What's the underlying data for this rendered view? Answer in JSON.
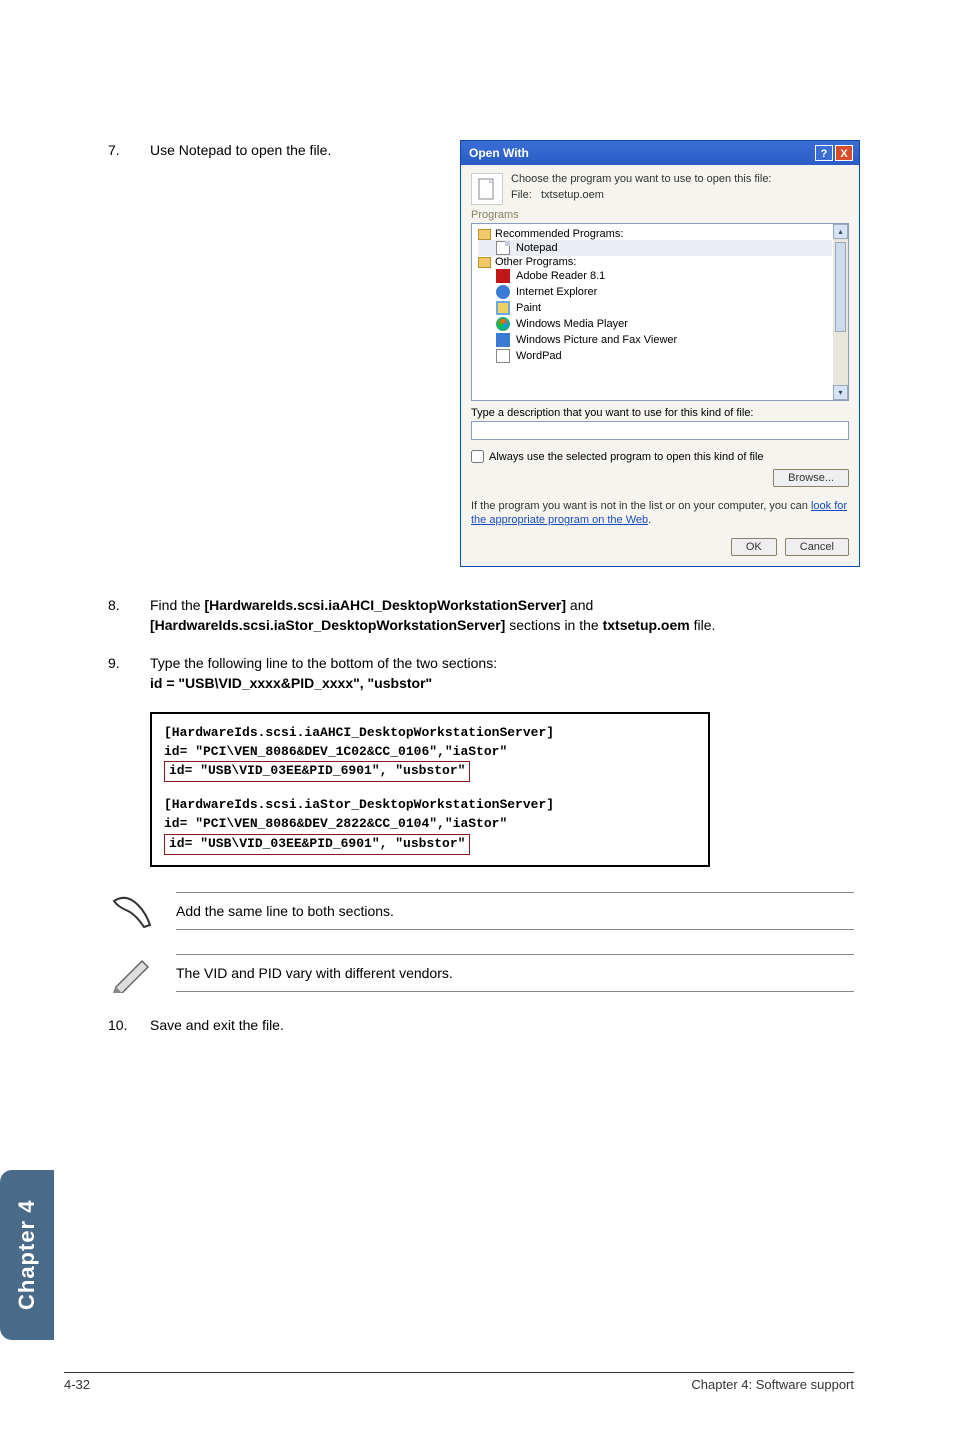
{
  "steps": {
    "s7": {
      "num": "7.",
      "text": "Use Notepad to open the file."
    },
    "s8": {
      "num": "8.",
      "prefix": "Find the ",
      "bold1": "[HardwareIds.scsi.iaAHCI_DesktopWorkstationServer]",
      "mid": " and ",
      "bold2": "[HardwareIds.scsi.iaStor_DesktopWorkstationServer]",
      "suffix1": " sections in the ",
      "bold3": "txtsetup.oem",
      "suffix2": " file."
    },
    "s9": {
      "num": "9.",
      "line1": "Type the following line to the bottom of the two sections:",
      "line2": "id = \"USB\\VID_xxxx&PID_xxxx\", \"usbstor\""
    },
    "s10": {
      "num": "10.",
      "text": "Save and exit the file."
    }
  },
  "dialog": {
    "title": "Open With",
    "help": "?",
    "close": "X",
    "choose": "Choose the program you want to use to open this file:",
    "file_label": "File:",
    "file_name": "txtsetup.oem",
    "programs_label": "Programs",
    "group_recommended": "Recommended Programs:",
    "prog_notepad": "Notepad",
    "group_other": "Other Programs:",
    "prog_adobe": "Adobe Reader 8.1",
    "prog_ie": "Internet Explorer",
    "prog_paint": "Paint",
    "prog_wmp": "Windows Media Player",
    "prog_wpfv": "Windows Picture and Fax Viewer",
    "prog_wordpad": "WordPad",
    "desc_label": "Type a description that you want to use for this kind of file:",
    "always_label": "Always use the selected program to open this kind of file",
    "browse": "Browse...",
    "help_text1": "If the program you want is not in the list or on your computer, you can ",
    "help_link": "look for the appropriate program on the Web",
    "help_text2": ".",
    "ok": "OK",
    "cancel": "Cancel"
  },
  "code": {
    "l1": "[HardwareIds.scsi.iaAHCI_DesktopWorkstationServer]",
    "l2": "id= \"PCI\\VEN_8086&DEV_1C02&CC_0106\",\"iaStor\"",
    "l3": "id= \"USB\\VID_03EE&PID_6901\", \"usbstor\"",
    "l4": "[HardwareIds.scsi.iaStor_DesktopWorkstationServer]",
    "l5": "id= \"PCI\\VEN_8086&DEV_2822&CC_0104\",\"iaStor\"",
    "l6": "id= \"USB\\VID_03EE&PID_6901\", \"usbstor\""
  },
  "notes": {
    "n1": "Add the same line to both sections.",
    "n2": "The VID and PID vary with different vendors."
  },
  "sidetab": "Chapter 4",
  "footer": {
    "left": "4-32",
    "right": "Chapter 4: Software support"
  }
}
